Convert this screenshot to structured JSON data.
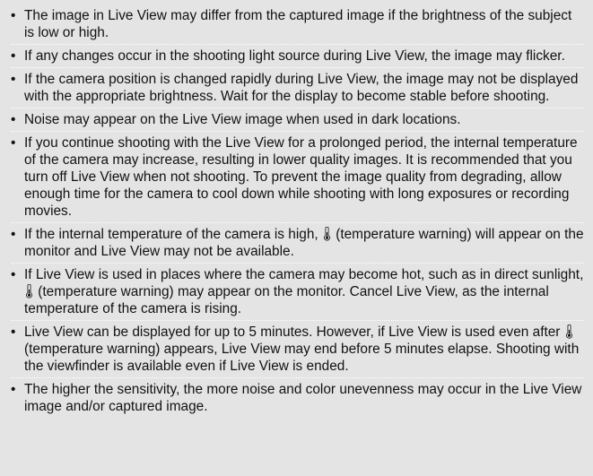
{
  "bullet_char": "•",
  "notes": [
    {
      "parts": [
        "The image in Live View may differ from the captured image if the brightness of the subject is low or high."
      ]
    },
    {
      "parts": [
        "If any changes occur in the shooting light source during Live View, the image may flicker."
      ]
    },
    {
      "parts": [
        "If the camera position is changed rapidly during Live View, the image may not be displayed with the appropriate brightness. Wait for the display to become stable before shooting."
      ]
    },
    {
      "parts": [
        "Noise may appear on the Live View image when used in dark locations."
      ]
    },
    {
      "parts": [
        "If you continue shooting with the Live View for a prolonged period, the internal temperature of the camera may increase, resulting in lower quality images. It is recommended that you turn off Live View when not shooting. To prevent the image quality from degrading, allow enough time for the camera to cool down while shooting with long exposures or recording movies."
      ]
    },
    {
      "parts": [
        "If the internal temperature of the camera is high,",
        " (temperature warning) will appear on the monitor and Live View may not be available."
      ],
      "icon": "thermometer-warning-icon"
    },
    {
      "parts": [
        "If Live View is used in places where the camera may become hot, such as in direct sunlight,",
        " (temperature warning) may appear on the monitor. Cancel Live View, as the internal temperature of the camera is rising."
      ],
      "icon": "thermometer-warning-icon"
    },
    {
      "parts": [
        "Live View can be displayed for up to 5 minutes. However, if Live View is used even after",
        " (temperature warning) appears, Live View may end before 5 minutes elapse. Shooting with the viewfinder is available even if Live View is ended."
      ],
      "icon": "thermometer-warning-icon"
    },
    {
      "parts": [
        "The higher the sensitivity, the more noise and color unevenness may occur in the Live View image and/or captured image."
      ]
    }
  ]
}
